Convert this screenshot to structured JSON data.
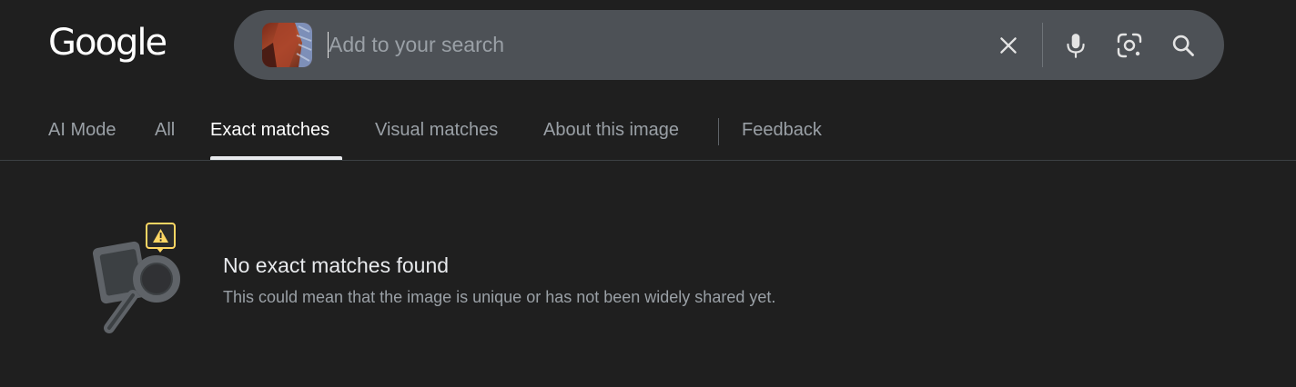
{
  "logo": {
    "text": "Google"
  },
  "search": {
    "placeholder": "Add to your search",
    "value": "",
    "icons": [
      "clear-icon",
      "microphone-icon",
      "lens-camera-icon",
      "search-icon"
    ]
  },
  "tabs": [
    {
      "label": "AI Mode",
      "active": false
    },
    {
      "label": "All",
      "active": false
    },
    {
      "label": "Exact matches",
      "active": true
    },
    {
      "label": "Visual matches",
      "active": false
    },
    {
      "label": "About this image",
      "active": false
    },
    {
      "label": "Feedback",
      "active": false
    }
  ],
  "empty_state": {
    "title": "No exact matches found",
    "subtitle": "This could mean that the image is unique or has not been widely shared yet.",
    "icon": "no-results-magnifier-icon"
  },
  "colors": {
    "background": "#1f1f1f",
    "searchbar": "#4d5156",
    "warning": "#fdd663"
  }
}
